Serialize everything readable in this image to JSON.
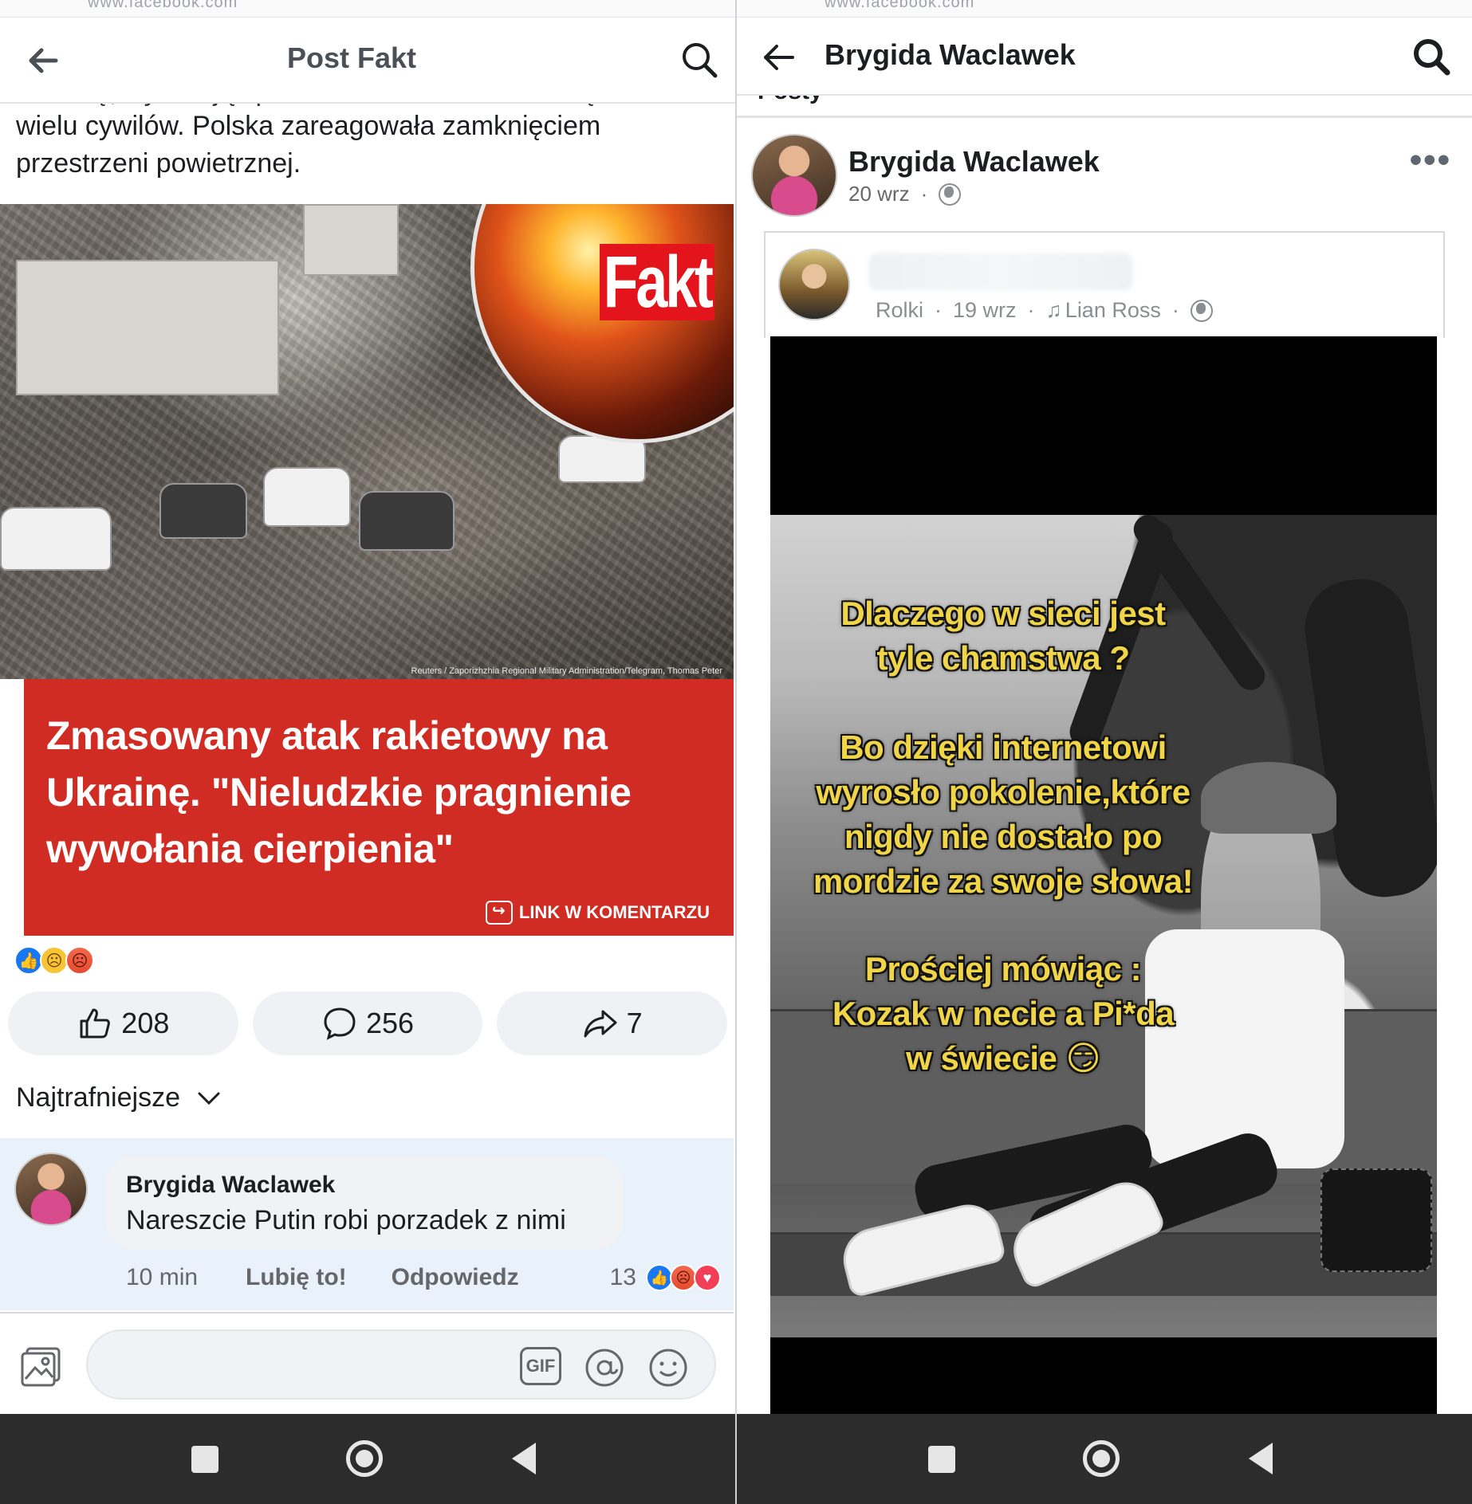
{
  "left": {
    "url_remnant": "www.facebook.com",
    "header": {
      "title": "Post Fakt"
    },
    "post": {
      "text_cut": "Ukrainę, wywołując poważne zniszczenia i raniąc",
      "text_lines": [
        "wielu cywilów. Polska zareagowała zamknięciem",
        "przestrzeni powietrznej."
      ],
      "image_logo": "Fakt",
      "image_credit": "Reuters / Zaporizhzhia Regional Military Administration/Telegram, Thomas Peter",
      "banner_headline": "Zmasowany atak rakietowy na Ukrainę. \"Nieludzkie pragnienie wywołania cierpienia\"",
      "banner_link": "LINK W KOMENTARZU"
    },
    "reactions": [
      "like",
      "sad",
      "angry"
    ],
    "actions": {
      "likes": "208",
      "comments": "256",
      "shares": "7"
    },
    "sort_label": "Najtrafniejsze",
    "comment": {
      "author": "Brygida Waclawek",
      "text": "Nareszcie Putin robi porzadek z nimi",
      "time": "10 min",
      "like_label": "Lubię to!",
      "reply_label": "Odpowiedz",
      "reaction_count": "13"
    },
    "composer": {
      "gif_label": "GIF"
    }
  },
  "right": {
    "url_remnant": "www.facebook.com",
    "header": {
      "title": "Brygida Waclawek"
    },
    "section_label": "Posty",
    "post": {
      "author": "Brygida Waclawek",
      "date": "20 wrz",
      "shared": {
        "type": "Rolki",
        "date": "19 wrz",
        "music": "Lian Ross"
      },
      "meme_lines_1": [
        "Dlaczego w sieci jest",
        "tyle chamstwa ?"
      ],
      "meme_lines_2": [
        "Bo dzięki internetowi",
        "wyrosło pokolenie,które",
        "nigdy nie dostało po",
        "mordzie za swoje słowa!"
      ],
      "meme_lines_3": [
        "Prościej mówiąc :",
        "Kozak w necie a Pi*da",
        "w świecie 😏"
      ]
    }
  },
  "colors": {
    "fb_blue": "#1877f2",
    "fakt_red": "#d12c23",
    "meme_yellow": "#f1d548",
    "nav_bg": "#2c2c2c"
  }
}
